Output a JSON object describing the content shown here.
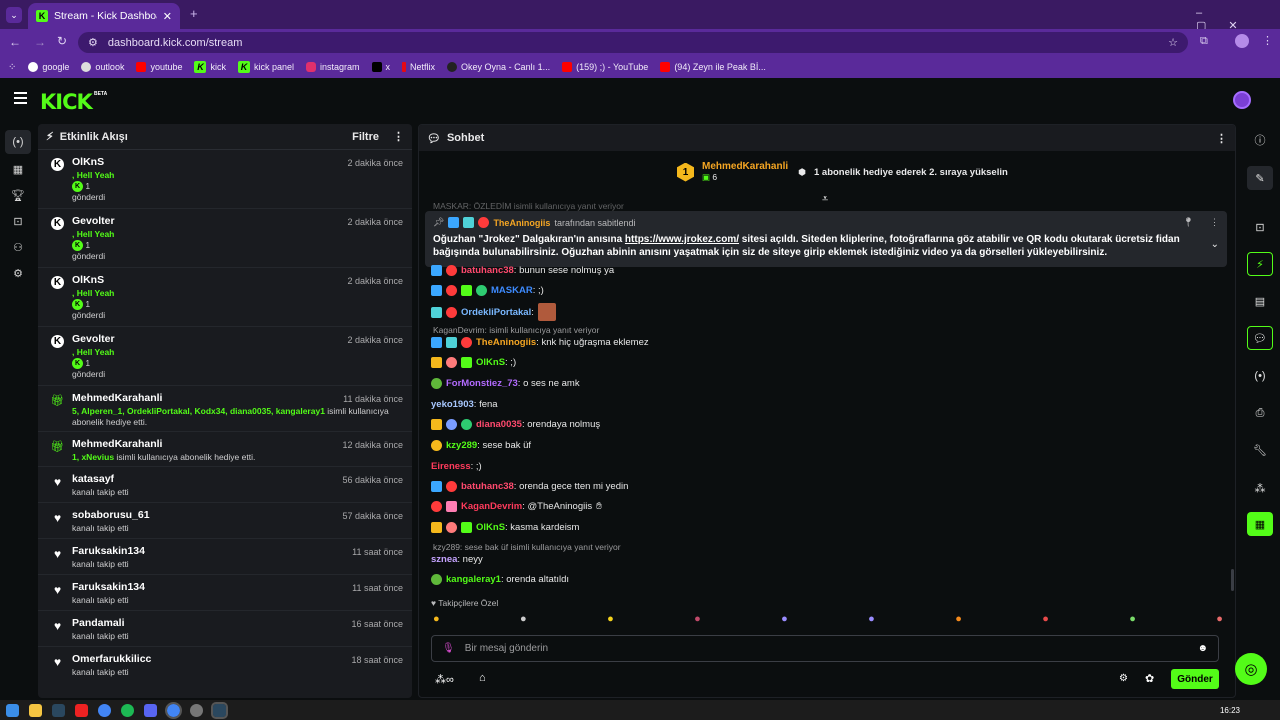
{
  "browser": {
    "tab_title": "Stream - Kick Dashboard",
    "url": "dashboard.kick.com/stream",
    "bookmarks": [
      "google",
      "outlook",
      "youtube",
      "kick",
      "kick panel",
      "instagram",
      "x",
      "Netflix",
      "Okey Oyna - Canlı 1...",
      "(159) ;) - YouTube",
      "(94) Zeyn ile Peak Bİ..."
    ]
  },
  "header": {
    "logo": "KICK",
    "beta": "BETA"
  },
  "activity": {
    "title": "Etkinlik Akışı",
    "filter": "Filtre",
    "items": [
      {
        "name": "OlKnS",
        "time": "2 dakika önce",
        "line1": ", Hell Yeah",
        "count": "1",
        "line2": "gönderdi"
      },
      {
        "name": "Gevolter",
        "time": "2 dakika önce",
        "line1": ", Hell Yeah",
        "count": "1",
        "line2": "gönderdi"
      },
      {
        "name": "OlKnS",
        "time": "2 dakika önce",
        "line1": ", Hell Yeah",
        "count": "1",
        "line2": "gönderdi"
      },
      {
        "name": "Gevolter",
        "time": "2 dakika önce",
        "line1": ", Hell Yeah",
        "count": "1",
        "line2": "gönderdi"
      }
    ],
    "gifts": [
      {
        "name": "MehmedKarahanli",
        "time": "11 dakika önce",
        "green": "5, Alperen_1, OrdekliPortakal, Kodx34, diana0035, kangaleray1",
        "rest": " isimli kullanıcıya abonelik hediye etti."
      },
      {
        "name": "MehmedKarahanli",
        "time": "12 dakika önce",
        "green": "1, xNevius",
        "rest": " isimli kullanıcıya abonelik hediye etti."
      }
    ],
    "follows": [
      {
        "name": "katasayf",
        "time": "56 dakika önce",
        "text": "kanalı takip etti"
      },
      {
        "name": "sobaborusu_61",
        "time": "57 dakika önce",
        "text": "kanalı takip etti"
      },
      {
        "name": "Faruksakin134",
        "time": "11 saat önce",
        "text": "kanalı takip etti"
      },
      {
        "name": "Faruksakin134",
        "time": "11 saat önce",
        "text": "kanalı takip etti"
      },
      {
        "name": "Pandamali",
        "time": "16 saat önce",
        "text": "kanalı takip etti"
      },
      {
        "name": "Omerfarukkilicc",
        "time": "18 saat önce",
        "text": "kanalı takip etti"
      }
    ]
  },
  "chat": {
    "title": "Sohbet",
    "top_gifter": {
      "rank": "1",
      "name": "MehmedKarahanli",
      "count": "6",
      "promo": "1 abonelik hediye ederek 2. sıraya yükselin"
    },
    "pinned": {
      "pinner": "TheAninogiis",
      "pinned_by": "tarafından sabitlendi",
      "body_pre": "Oğuzhan \"Jrokez\" Dalgakıran'ın anısına ",
      "link": "https://www.jrokez.com/",
      "body_post": " sitesi açıldı. Siteden kliplerine, fotoğraflarına göz atabilir ve QR kodu okutarak ücretsiz fidan bağışında bulunabilirsiniz. Oğuzhan abinin anısını yaşatmak için siz de siteye girip eklemek istediğiniz video ya da görselleri yükleyebilirsiniz."
    },
    "messages": [
      {
        "user": "batuhanc38",
        "text": ": bunun sese nolmuş ya",
        "color": "#ff4a6e"
      },
      {
        "user": "MASKAR",
        "text": ": ;)",
        "color": "#3d8bff"
      },
      {
        "user": "OrdekliPortakal",
        "text": ":",
        "color": "#7ab8ff"
      },
      {
        "user": "TheAninogiis",
        "text": ": knk hiç uğraşma eklemez",
        "color": "#f5a623"
      },
      {
        "user": "OlKnS",
        "text": ": ;)",
        "color": "#53fc18"
      },
      {
        "user": "ForMonstiez_73",
        "text": ": o ses ne amk",
        "color": "#b36bff"
      },
      {
        "user": "yeko1903",
        "text": ": fena",
        "color": "#a8c8ff"
      },
      {
        "user": "diana0035",
        "text": ": orendaya nolmuş",
        "color": "#ff4a6e"
      },
      {
        "user": "kzy289",
        "text": ": sese bak üf",
        "color": "#53fc18"
      },
      {
        "user": "Eireness",
        "text": ": ;)",
        "color": "#ff3b5c"
      },
      {
        "user": "batuhanc38",
        "text": ": orenda gece tten mi yedin",
        "color": "#ff4a6e"
      },
      {
        "user": "KaganDevrim",
        "text": ": @TheAninogiis",
        "color": "#ff3b5c"
      },
      {
        "user": "OlKnS",
        "text": ": kasma kardeism",
        "color": "#53fc18"
      },
      {
        "user": "szneа",
        "text": ": neyy",
        "color": "#c5a3ff"
      },
      {
        "user": "kangaleray1",
        "text": ": orenda altatıldı",
        "color": "#53fc18"
      }
    ],
    "reply1": "KaganDevrim:   isimli kullanıcıya yanıt veriyor",
    "reply2": "kzy289: sese bak üf isimli kullanıcıya yanıt veriyor",
    "top_reply": "MASKAR: ÖZLEDİM isimli kullanıcıya yanıt veriyor",
    "followers_only": "Takipçilere Özel",
    "placeholder": "Bir mesaj gönderin",
    "send": "Gönder"
  },
  "taskbar": {
    "time": "16:23"
  }
}
